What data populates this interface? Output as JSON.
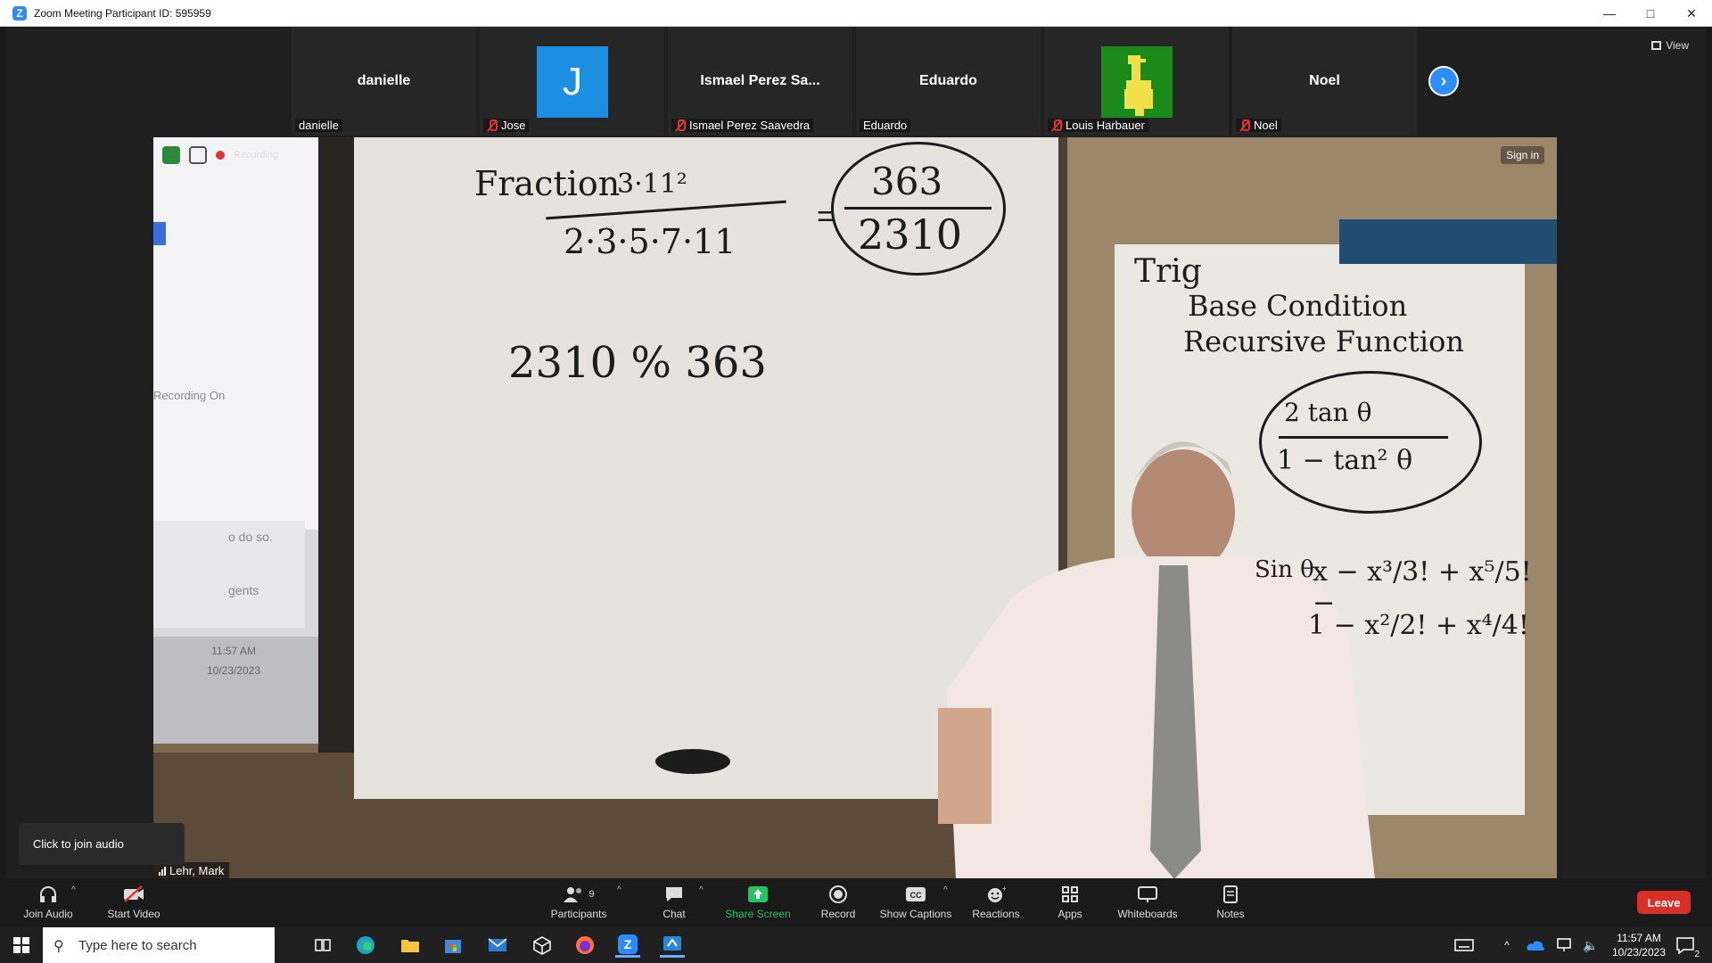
{
  "window": {
    "title": "Zoom Meeting Participant ID: 595959"
  },
  "top_bar": {
    "view_label": "View"
  },
  "participants_strip": [
    {
      "display": "danielle",
      "label": "danielle",
      "muted": false,
      "avatar": "none"
    },
    {
      "display": "J",
      "label": "Jose",
      "muted": true,
      "avatar": "letter"
    },
    {
      "display": "Ismael Perez Sa...",
      "label": "Ismael Perez Saavedra",
      "muted": true,
      "avatar": "none"
    },
    {
      "display": "Eduardo",
      "label": "Eduardo",
      "muted": false,
      "avatar": "none"
    },
    {
      "display": "",
      "label": "Louis Harbauer",
      "muted": true,
      "avatar": "duck-image"
    },
    {
      "display": "Noel",
      "label": "Noel",
      "muted": true,
      "avatar": "none"
    }
  ],
  "main_video": {
    "speaker": "Lehr, Mark",
    "sign_in": "Sign in",
    "overlay_recording_label": "Recording",
    "overlay_recording_on": "Recording On",
    "overlay_partial_text_1": "o do so.",
    "overlay_partial_text_2": "gents",
    "overlay_time": "11:57 AM",
    "overlay_date": "10/23/2023",
    "board_left": {
      "line1": "Fraction",
      "numerator": "3·11²",
      "denominator": "2·3·5·7·11",
      "result_num": "363",
      "result_den": "2310",
      "line2": "2310 % 363"
    },
    "board_right": {
      "line1": "Trig",
      "line2": "Base Condition",
      "line3": "Recursive Function",
      "formula_num": "2 tan θ",
      "formula_den": "1 − tan² θ",
      "sin_label": "Sin θ",
      "sin_series": "x − x³/3! + x⁵/5! −",
      "cos_series": "1 − x²/2! + x⁴/4!"
    }
  },
  "audio_tooltip": "Click to join audio",
  "toolbar": {
    "join_audio": "Join Audio",
    "start_video": "Start Video",
    "participants": "Participants",
    "participants_count": "9",
    "chat": "Chat",
    "share_screen": "Share Screen",
    "record": "Record",
    "show_captions": "Show Captions",
    "reactions": "Reactions",
    "apps": "Apps",
    "whiteboards": "Whiteboards",
    "notes": "Notes",
    "leave": "Leave"
  },
  "taskbar": {
    "search_placeholder": "Type here to search",
    "time": "11:57 AM",
    "date": "10/23/2023",
    "notification_count": "2"
  },
  "colors": {
    "zoom_blue": "#2d8cff",
    "leave_red": "#d93025",
    "share_green": "#22c55e",
    "muted_red": "#e0332f"
  }
}
